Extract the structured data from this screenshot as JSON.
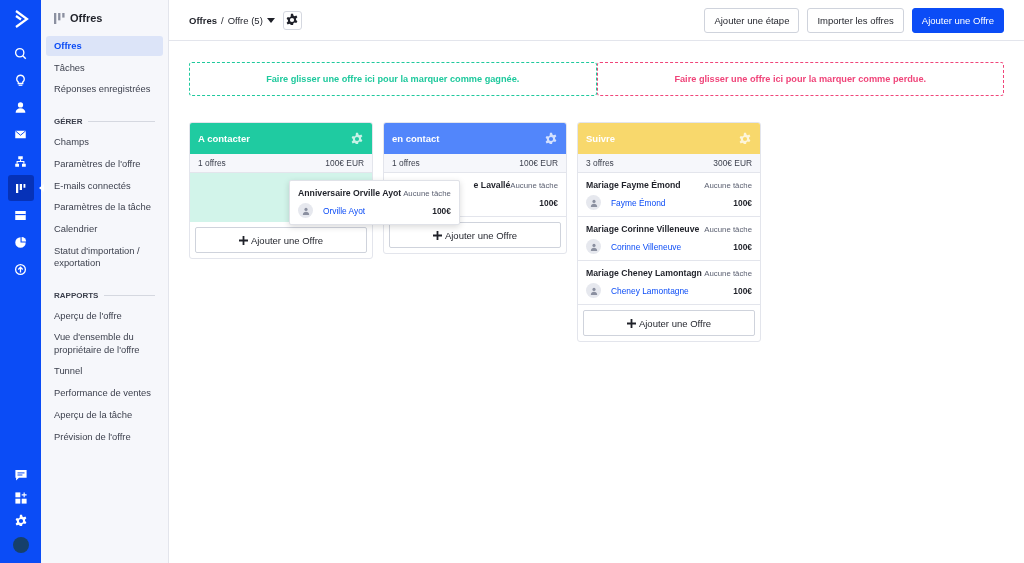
{
  "rail": {
    "top": [
      {
        "selected": false
      },
      {
        "selected": false
      },
      {
        "selected": false
      },
      {
        "selected": false
      },
      {
        "selected": false
      },
      {
        "selected": true
      },
      {
        "selected": false
      },
      {
        "selected": false
      },
      {
        "selected": false
      }
    ]
  },
  "sidebar": {
    "title": "Offres",
    "items": [
      {
        "label": "Offres",
        "selected": true
      },
      {
        "label": "Tâches",
        "selected": false
      },
      {
        "label": "Réponses enregistrées",
        "selected": false
      }
    ],
    "sections": [
      {
        "heading": "GÉRER",
        "items": [
          {
            "label": "Champs",
            "selected": false
          },
          {
            "label": "Paramètres de l'offre",
            "selected": false
          },
          {
            "label": "E-mails connectés",
            "selected": false
          },
          {
            "label": "Paramètres de la tâche",
            "selected": false
          },
          {
            "label": "Calendrier",
            "selected": false
          },
          {
            "label": "Statut d'importation / exportation",
            "selected": false
          }
        ]
      },
      {
        "heading": "RAPPORTS",
        "items": [
          {
            "label": "Aperçu de l'offre",
            "selected": false
          },
          {
            "label": "Vue d'ensemble du propriétaire de l'offre",
            "selected": false
          },
          {
            "label": "Tunnel",
            "selected": false
          },
          {
            "label": "Performance de ventes",
            "selected": false
          },
          {
            "label": "Aperçu de la tâche",
            "selected": false
          },
          {
            "label": "Prévision de l'offre",
            "selected": false
          }
        ]
      }
    ]
  },
  "breadcrumb": {
    "root": "Offres",
    "separator": "/",
    "current": "Offre (5)"
  },
  "buttons": [
    {
      "label": "Ajouter une étape",
      "kind": "secondary"
    },
    {
      "label": "Importer les offres",
      "kind": "secondary"
    },
    {
      "label": "Ajouter une Offre",
      "kind": "primary"
    }
  ],
  "drop_zones": [
    {
      "text": "Faire glisser une offre ici pour la marquer comme gagnée.",
      "color": "#1fc99d"
    },
    {
      "text": "Faire glisser une offre ici pour la marquer comme perdue.",
      "color": "#f0457a"
    }
  ],
  "columns": [
    {
      "name": "A contacter",
      "color": "#1fcba1",
      "count": "1 offres",
      "total": "100€ EUR",
      "drop_placeholder": true,
      "add_label": "Ajouter une Offre"
    },
    {
      "name": "en contact",
      "color": "#5286fb",
      "count": "1 offres",
      "total": "100€ EUR",
      "drop_placeholder": false,
      "deals": [
        {
          "title": "e Lavallé",
          "tasks": "Aucune tâche",
          "amount": "100€",
          "covered": true
        }
      ],
      "add_label": "Ajouter une Offre"
    },
    {
      "name": "Suivre",
      "color": "#f8d86c",
      "count": "3 offres",
      "total": "300€ EUR",
      "drop_placeholder": false,
      "deals": [
        {
          "title": "Mariage Fayme Émond",
          "tasks": "Aucune tâche",
          "contact": "Fayme Émond",
          "amount": "100€",
          "covered": false
        },
        {
          "title": "Mariage Corinne Villeneuve",
          "tasks": "Aucune tâche",
          "contact": "Corinne Villeneuve",
          "amount": "100€",
          "covered": false
        },
        {
          "title": "Mariage Cheney Lamontagn",
          "tasks": "Aucune tâche",
          "contact": "Cheney Lamontagne",
          "amount": "100€",
          "covered": false
        }
      ],
      "add_label": "Ajouter une Offre"
    }
  ],
  "dragged_deal": {
    "title": "Anniversaire Orville Ayot",
    "tasks": "Aucune tâche",
    "contact": "Orville Ayot",
    "amount": "100€"
  }
}
